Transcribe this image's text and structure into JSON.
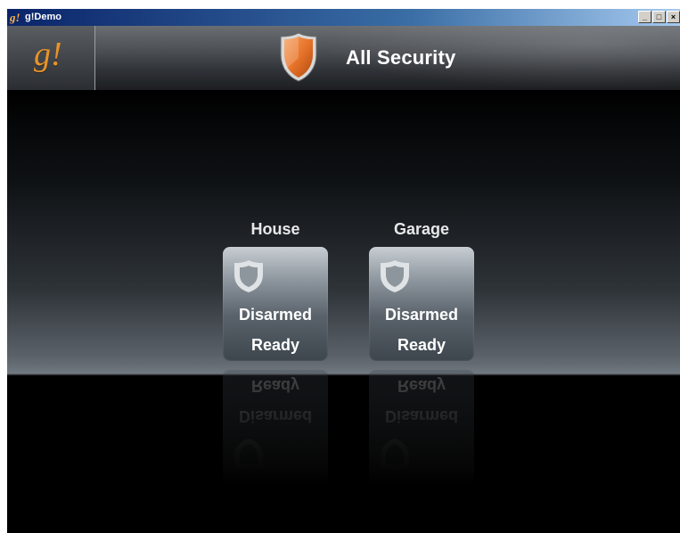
{
  "window": {
    "title": "g!Demo",
    "app_icon_text": "g!",
    "buttons": [
      "minimize",
      "maximize",
      "close"
    ]
  },
  "header": {
    "logo": "g!",
    "title": "All Security",
    "shield_color": "#e8742a"
  },
  "panels": [
    {
      "label": "House",
      "arm_state": "Disarmed",
      "ready_state": "Ready"
    },
    {
      "label": "Garage",
      "arm_state": "Disarmed",
      "ready_state": "Ready"
    }
  ],
  "colors": {
    "accent": "#e8942a",
    "background": "#000000",
    "title_bar": "#0a246a"
  }
}
